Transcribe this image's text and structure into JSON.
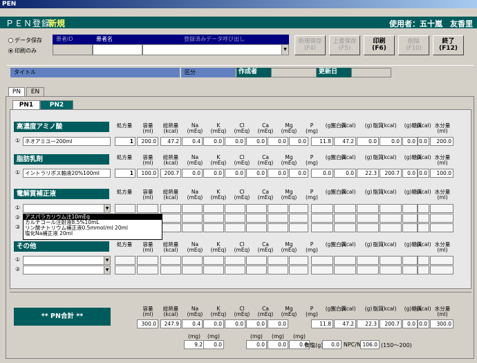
{
  "window_title": "PEN",
  "header": {
    "title": "ＰＥＮ登録",
    "mode": "新規",
    "user_label": "使用者：",
    "user_name": "五十嵐　友香里"
  },
  "radios": [
    {
      "label": "データ保存",
      "checked": false
    },
    {
      "label": "印刷のみ",
      "checked": true
    }
  ],
  "patient": {
    "id_label": "患者ID",
    "name_label": "患者名",
    "saved_data_label": "登録済みデータ呼び出し"
  },
  "buttons": {
    "new_save": [
      "新規保存",
      "(F4)"
    ],
    "overwrite": [
      "上書保存",
      "(F5)"
    ],
    "print": [
      "印刷",
      "(F6)"
    ],
    "delete": [
      "削除",
      "(F10)"
    ],
    "exit": [
      "終了",
      "(F12)"
    ]
  },
  "meta": {
    "title_label": "タイトル",
    "category_label": "区分",
    "author_label": "作成者",
    "updated_label": "更新日"
  },
  "outer_tabs": [
    "PN",
    "EN"
  ],
  "inner_tabs": [
    "PN1",
    "PN2"
  ],
  "columns": [
    [
      "処方量",
      ""
    ],
    [
      "容量",
      "(ml)"
    ],
    [
      "総熱量",
      "(kcal)"
    ],
    [
      "Na",
      "(mEq)"
    ],
    [
      "K",
      "(mEq)"
    ],
    [
      "Cl",
      "(mEq)"
    ],
    [
      "Ca",
      "(mEq)"
    ],
    [
      "Mg",
      "(mEq)"
    ],
    [
      "P",
      "(mg)"
    ],
    [
      "",
      "(g)"
    ],
    [
      "",
      "(kcal)"
    ],
    [
      "",
      "(g)"
    ],
    [
      "",
      "(kcal)"
    ],
    [
      "",
      "(g)"
    ],
    [
      "",
      "(kcal)"
    ],
    [
      "水分量",
      "(ml)"
    ]
  ],
  "groups": {
    "protein": "蛋白質",
    "fat": "脂質",
    "sugar": "糖質"
  },
  "sections": {
    "amino": {
      "title": "高濃度アミノ酸",
      "row": {
        "idx": "①",
        "name": "ネオアミユー200ml",
        "qty": "1",
        "values": [
          "200.0",
          "47.2",
          "0.4",
          "0.0",
          "0.0",
          "0.0",
          "0.0",
          "0.0",
          "11.8",
          "47.2",
          "0.0",
          "0.0",
          "0.0",
          "0.0",
          "200.0"
        ]
      }
    },
    "fat": {
      "title": "脂肪乳剤",
      "row": {
        "idx": "①",
        "name": "イントラリポス輸液20%100ml",
        "qty": "1",
        "values": [
          "100.0",
          "200.7",
          "0.0",
          "0.0",
          "0.0",
          "0.0",
          "0.0",
          "0.0",
          "0.0",
          "0.0",
          "22.3",
          "200.7",
          "0.0",
          "0.0",
          "100.0"
        ]
      }
    },
    "electrolyte": {
      "title": "電解質補正液",
      "rows": [
        "①",
        "②",
        "③"
      ],
      "dropdown": [
        "アスパラカリウム注10mEq",
        "カルチコール注射液8.5%10mL",
        "リン酸ナトリウム補正液0.5mmol/ml 20ml",
        "塩化Na補正液 20ml"
      ]
    },
    "other": {
      "title": "その他",
      "rows": [
        "①",
        "②"
      ]
    }
  },
  "summary": {
    "label": "** PN合計 **",
    "values": [
      "300.0",
      "247.9",
      "0.4",
      "0.0",
      "0.0",
      "0.0",
      "0.0",
      "",
      "11.8",
      "47.2",
      "22.3",
      "200.7",
      "0.0",
      "0.0",
      "300.0"
    ],
    "sub_units": [
      "(mg)",
      "(mg)",
      "(mg)",
      "(mg)",
      "(mg)"
    ],
    "sub_values": [
      "9.2",
      "0.0",
      "0.0",
      "0.0",
      "0.0"
    ],
    "salt_label": "食塩(g)",
    "salt_value": "0.0",
    "npc_label": "NPC/N",
    "npc_value": "106.0",
    "npc_range": "(150〜200)"
  }
}
